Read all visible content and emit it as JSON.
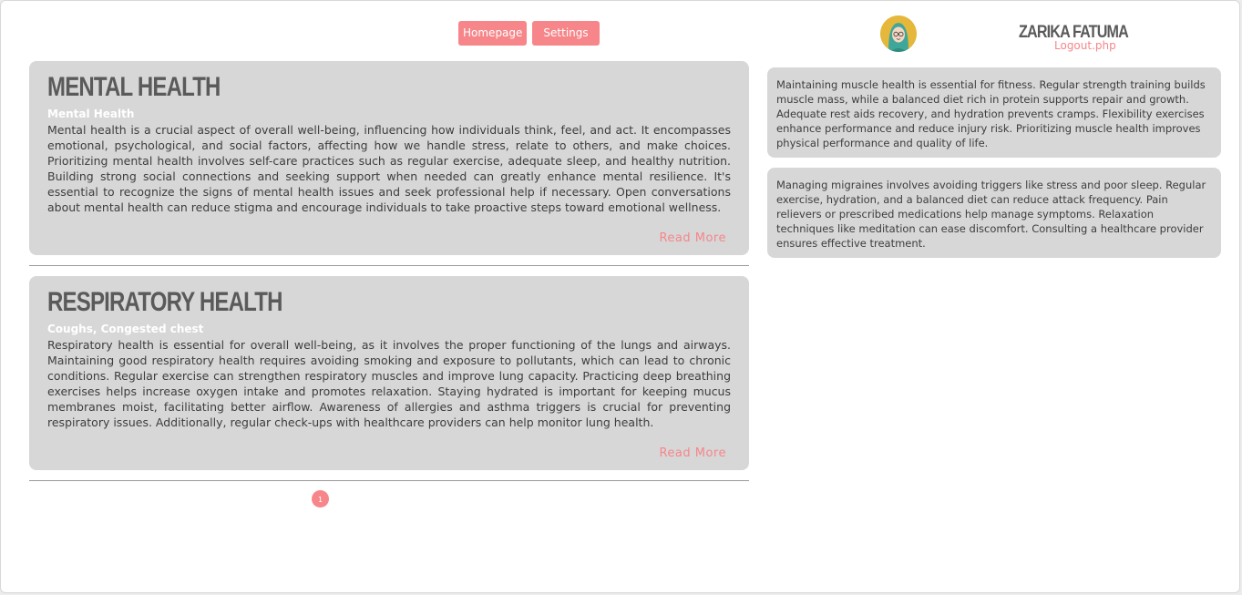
{
  "nav": {
    "homepage_label": "Homepage",
    "settings_label": "Settings"
  },
  "user": {
    "name": "ZARIKA FATUMA",
    "logout_label": "Logout.php",
    "avatar_icon": "hijab-woman-avatar-icon"
  },
  "articles": [
    {
      "title": "MENTAL HEALTH",
      "subtitle": "Mental Health",
      "body": "Mental health is a crucial aspect of overall well-being, influencing how individuals think, feel, and act. It encompasses emotional, psychological, and social factors, affecting how we handle stress, relate to others, and make choices. Prioritizing mental health involves self-care practices such as regular exercise, adequate sleep, and healthy nutrition. Building strong social connections and seeking support when needed can greatly enhance mental resilience. It's essential to recognize the signs of mental health issues and seek professional help if necessary. Open conversations about mental health can reduce stigma and encourage individuals to take proactive steps toward emotional wellness.",
      "read_more": "Read More"
    },
    {
      "title": "RESPIRATORY HEALTH",
      "subtitle": "Coughs, Congested chest",
      "body": "Respiratory health is essential for overall well-being, as it involves the proper functioning of the lungs and airways. Maintaining good respiratory health requires avoiding smoking and exposure to pollutants, which can lead to chronic conditions. Regular exercise can strengthen respiratory muscles and improve lung capacity. Practicing deep breathing exercises helps increase oxygen intake and promotes relaxation. Staying hydrated is important for keeping mucus membranes moist, facilitating better airflow. Awareness of allergies and asthma triggers is crucial for preventing respiratory issues. Additionally, regular check-ups with healthcare providers can help monitor lung health.",
      "read_more": "Read More"
    }
  ],
  "pagination": {
    "current_page": "1"
  },
  "sidebar": {
    "tips": [
      "Maintaining muscle health is essential for fitness. Regular strength training builds muscle mass, while a balanced diet rich in protein supports repair and growth. Adequate rest aids recovery, and hydration prevents cramps. Flexibility exercises enhance performance and reduce injury risk. Prioritizing muscle health improves physical performance and quality of life.",
      "Managing migraines involves avoiding triggers like stress and poor sleep. Regular exercise, hydration, and a balanced diet can reduce attack frequency. Pain relievers or prescribed medications help manage symptoms. Relaxation techniques like meditation can ease discomfort. Consulting a healthcare provider ensures effective treatment."
    ]
  },
  "colors": {
    "accent": "#f6868a",
    "card_bg": "#d7d7d7",
    "title_text": "#5a5a5a",
    "avatar_bg": "#e5b73b"
  }
}
